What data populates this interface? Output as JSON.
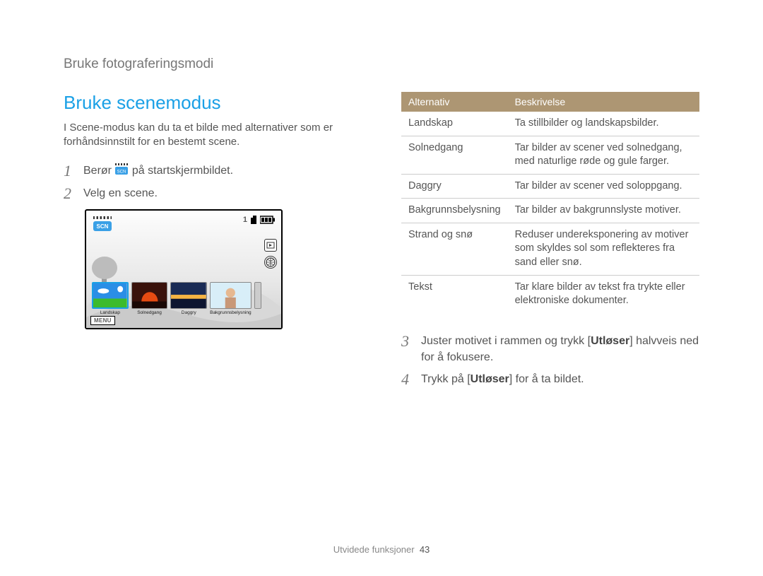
{
  "breadcrumb": "Bruke fotograferingsmodi",
  "title": "Bruke scenemodus",
  "intro": "I Scene-modus kan du ta et bilde med alternativer som er forhåndsinnstilt for en bestemt scene.",
  "steps_left": {
    "1_pre": "Berør ",
    "1_post": " på startskjermbildet.",
    "2": "Velg en scene."
  },
  "camera_screen": {
    "counter": "1",
    "menu": "MENU",
    "thumbs": [
      {
        "label": "Landskap"
      },
      {
        "label": "Solnedgang"
      },
      {
        "label": "Daggry"
      },
      {
        "label": "Bakgrunnsbelysning"
      }
    ]
  },
  "table": {
    "headers": {
      "a": "Alternativ",
      "b": "Beskrivelse"
    },
    "rows": [
      {
        "a": "Landskap",
        "b": "Ta stillbilder og landskapsbilder."
      },
      {
        "a": "Solnedgang",
        "b": "Tar bilder av scener ved solnedgang, med naturlige røde og gule farger."
      },
      {
        "a": "Daggry",
        "b": "Tar bilder av scener ved soloppgang."
      },
      {
        "a": "Bakgrunnsbelysning",
        "b": "Tar bilder av bakgrunnslyste motiver."
      },
      {
        "a": "Strand og snø",
        "b": "Reduser undereksponering av motiver som skyldes sol som reflekteres fra sand eller snø."
      },
      {
        "a": "Tekst",
        "b": "Tar klare bilder av tekst fra trykte eller elektroniske dokumenter."
      }
    ]
  },
  "steps_right": {
    "3_pre": "Juster motivet i rammen og trykk [",
    "3_bold": "Utløser",
    "3_post": "] halvveis ned for å fokusere.",
    "4_pre": "Trykk på [",
    "4_bold": "Utløser",
    "4_post": "] for å ta bildet."
  },
  "footer": {
    "section": "Utvidede funksjoner",
    "page": "43"
  }
}
